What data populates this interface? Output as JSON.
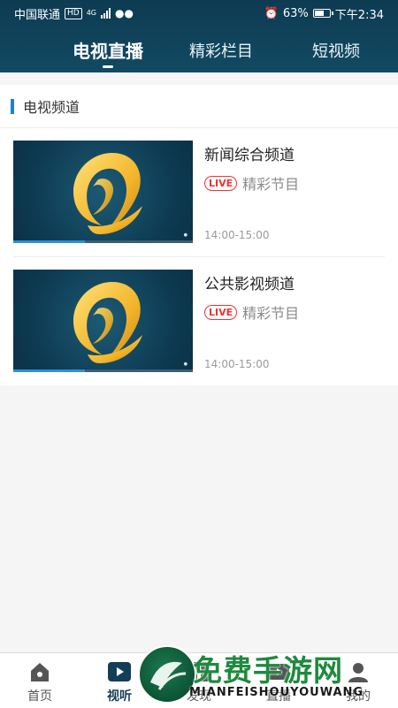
{
  "status_bar": {
    "carrier": "中国联通",
    "hd_tag": "HD",
    "network": "4G",
    "battery": "63%",
    "time": "下午2:34",
    "battery_level": 0.63
  },
  "header": {
    "tabs": [
      {
        "label": "电视直播",
        "active": true
      },
      {
        "label": "精彩栏目",
        "active": false
      },
      {
        "label": "短视频",
        "active": false
      }
    ]
  },
  "section": {
    "title": "电视频道",
    "channels": [
      {
        "name": "新闻综合频道",
        "live": "LIVE",
        "program": "精彩节目",
        "time": "14:00-15:00",
        "progress": 0.4
      },
      {
        "name": "公共影视频道",
        "live": "LIVE",
        "program": "精彩节目",
        "time": "14:00-15:00",
        "progress": 0.4
      }
    ]
  },
  "bottom_nav": {
    "items": [
      {
        "label": "首页",
        "icon": "home-icon",
        "active": false
      },
      {
        "label": "视听",
        "icon": "play-icon",
        "active": true
      },
      {
        "label": "发现",
        "icon": "discover-icon",
        "active": false
      },
      {
        "label": "直播",
        "icon": "live-icon",
        "active": false
      },
      {
        "label": "我的",
        "icon": "profile-icon",
        "active": false
      }
    ]
  },
  "watermark": {
    "title": "免费手游网",
    "subtitle": "MIANFEISHOUYOUWANG"
  },
  "colors": {
    "header_bg": "#0d3b52",
    "accent_blue": "#1f7fd4",
    "live_red": "#e33333",
    "watermark_green": "#1e8a3e"
  }
}
